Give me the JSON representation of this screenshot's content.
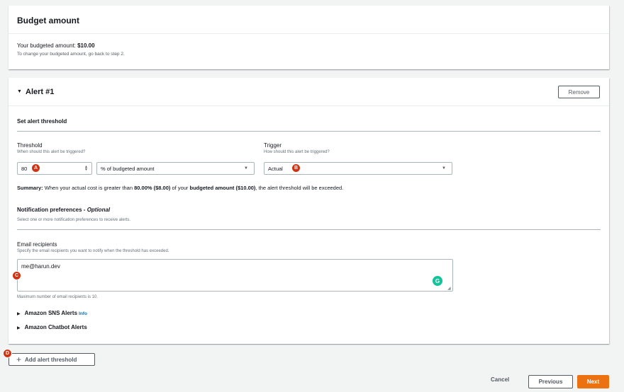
{
  "budget": {
    "title": "Budget amount",
    "amount_prefix": "Your budgeted amount: ",
    "amount_value": "$10.00",
    "note": "To change your budgeted amount, go back to step 2."
  },
  "alert": {
    "title": "Alert #1",
    "remove_label": "Remove",
    "threshold_section": "Set alert threshold",
    "threshold_label": "Threshold",
    "threshold_desc": "When should this alert be triggered?",
    "threshold_value": "80",
    "threshold_unit": "% of budgeted amount",
    "trigger_label": "Trigger",
    "trigger_desc": "How should this alert be triggered?",
    "trigger_value": "Actual",
    "summary": {
      "label": "Summary:",
      "part1": " When your actual cost is greater than ",
      "pct": "80.00% ($8.00)",
      "part2": " of your ",
      "budgeted": "budgeted amount ($10.00)",
      "part3": ", the alert threshold will be exceeded."
    },
    "notif_title": "Notification preferences - ",
    "notif_optional": "Optional",
    "notif_desc": "Select one or more notification preferences to receive alerts.",
    "email_label": "Email recipients",
    "email_desc": "Specify the email recipients you want to notify when the threshold has exceeded.",
    "email_value": "me@harun.dev",
    "email_note": "Maximum number of email recipients is 10.",
    "sns_label": "Amazon SNS Alerts",
    "sns_info": "Info",
    "chatbot_label": "Amazon Chatbot Alerts"
  },
  "badges": {
    "a": "A",
    "b": "B",
    "c": "C",
    "d": "D",
    "g": "G"
  },
  "footer": {
    "add_label": "Add alert threshold",
    "cancel_label": "Cancel",
    "previous_label": "Previous",
    "next_label": "Next"
  },
  "colors": {
    "primary": "#ec7211",
    "link": "#0073bb",
    "badge": "#d13212"
  }
}
